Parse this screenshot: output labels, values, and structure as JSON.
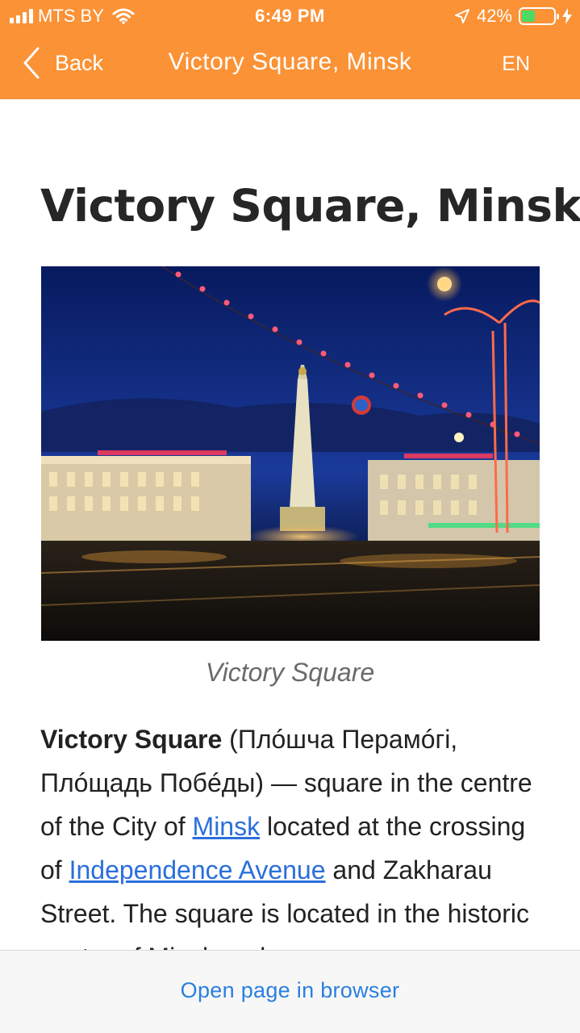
{
  "status_bar": {
    "carrier": "MTS BY",
    "time": "6:49 PM",
    "battery_percent": "42%",
    "battery_level": 0.42,
    "icons": [
      "signal-bars-icon",
      "wifi-icon",
      "location-arrow-icon",
      "battery-icon",
      "charging-bolt-icon"
    ]
  },
  "nav": {
    "back_label": "Back",
    "title": "Victory Square, Minsk",
    "language": "EN"
  },
  "article": {
    "title": "Victory Square, Minsk",
    "image_caption": "Victory Square",
    "intro": {
      "bold_term": "Victory Square",
      "text_1": " (Плóшча Перамóгі, Плóщадь Побéды) — square in the centre of the City of ",
      "link_1": "Minsk",
      "text_2": " located at the crossing of ",
      "link_2": "Independence Avenue",
      "text_3": " and Zakharau Street. The square is located in the historic centre of Minsk and"
    }
  },
  "bottom_bar": {
    "open_browser_label": "Open page in browser"
  },
  "colors": {
    "header_orange": "#fb9236",
    "link_blue": "#2a6fdc",
    "battery_green": "#4cd964"
  }
}
